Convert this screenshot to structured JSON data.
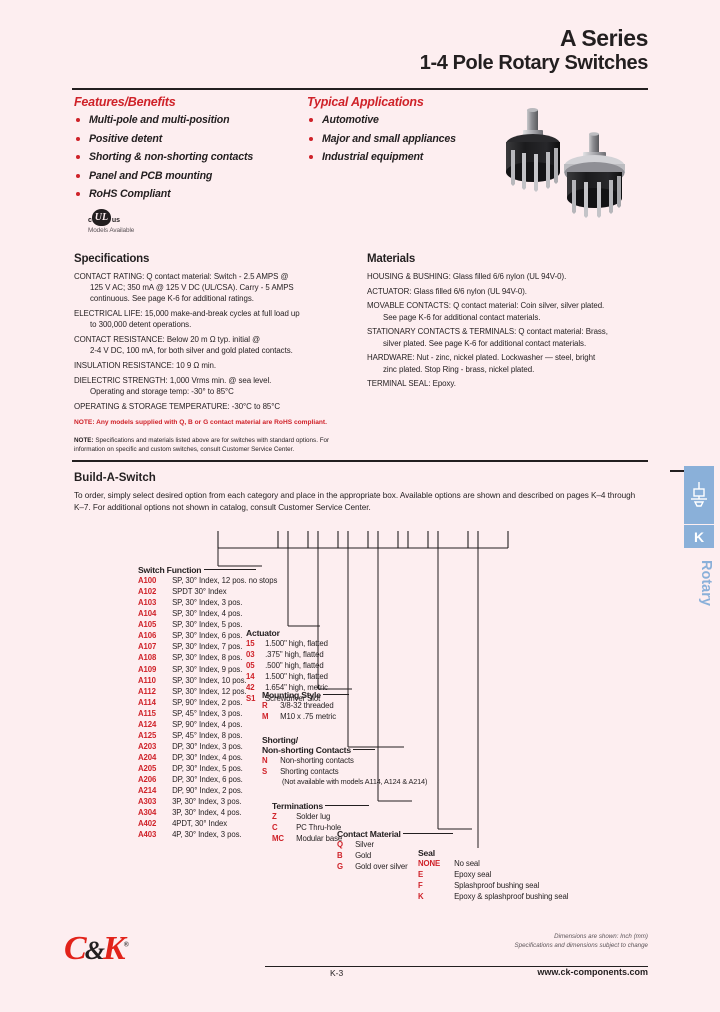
{
  "header": {
    "title": "A Series",
    "subtitle": "1-4 Pole Rotary Switches"
  },
  "features": {
    "heading": "Features/Benefits",
    "items": [
      "Multi-pole and multi-position",
      "Positive detent",
      "Shorting & non-shorting contacts",
      "Panel and PCB mounting",
      "RoHS Compliant"
    ],
    "ul_mark": {
      "left": "c",
      "mark": "UL",
      "right": "us",
      "caption": "Models Available"
    }
  },
  "applications": {
    "heading": "Typical Applications",
    "items": [
      "Automotive",
      "Major and small appliances",
      "Industrial equipment"
    ]
  },
  "specifications": {
    "heading": "Specifications",
    "items": [
      {
        "label": "CONTACT RATING:",
        "line1": "Q contact material: Switch - 2.5 AMPS @",
        "lines": [
          "125 V AC; 350 mA @ 125 V DC (UL/CSA). Carry - 5 AMPS",
          "continuous. See page K-6 for additional ratings."
        ]
      },
      {
        "label": "ELECTRICAL LIFE:",
        "line1": "15,000 make-and-break cycles at full load up",
        "lines": [
          "to 300,000 detent operations."
        ]
      },
      {
        "label": "CONTACT RESISTANCE:",
        "line1": "Below 20 m Ω typ. initial @",
        "lines": [
          "2-4 V DC, 100 mA, for both silver and gold plated contacts."
        ]
      },
      {
        "label": "INSULATION RESISTANCE:",
        "line1": "10 9 Ω min.",
        "lines": []
      },
      {
        "label": "DIELECTRIC STRENGTH:",
        "line1": "1,000 Vrms min. @ sea level.",
        "lines": [
          "Operating and storage temp: -30° to 85°C"
        ]
      },
      {
        "label": "OPERATING & STORAGE TEMPERATURE:",
        "line1": "-30°C to 85°C",
        "lines": []
      }
    ],
    "note_red": "NOTE: Any models supplied with Q, B or G contact material are RoHS compliant.",
    "note_black_bold": "NOTE:",
    "note_black": " Specifications and materials listed above are for switches with standard options. For information on specific and custom switches, consult Customer Service Center."
  },
  "materials": {
    "heading": "Materials",
    "items": [
      {
        "label": "HOUSING & BUSHING:",
        "line1": "Glass filled 6/6 nylon (UL 94V-0).",
        "lines": []
      },
      {
        "label": "ACTUATOR:",
        "line1": "Glass filled 6/6 nylon (UL 94V-0).",
        "lines": []
      },
      {
        "label": "MOVABLE CONTACTS:",
        "line1": "Q contact material: Coin silver, silver plated.",
        "lines": [
          "See page K-6 for additional contact materials."
        ]
      },
      {
        "label": "STATIONARY CONTACTS & TERMINALS:",
        "line1": "Q contact material: Brass,",
        "lines": [
          "silver plated. See page K-6 for additional contact materials."
        ]
      },
      {
        "label": "HARDWARE:",
        "line1": "Nut - zinc, nickel plated. Lockwasher — steel, bright",
        "lines": [
          "zinc plated. Stop Ring - brass, nickel plated."
        ]
      },
      {
        "label": "TERMINAL SEAL:",
        "line1": "Epoxy.",
        "lines": []
      }
    ]
  },
  "build_a_switch": {
    "heading": "Build-A-Switch",
    "intro": "To order, simply select desired option from each category and place in the appropriate box. Available options are shown and described on pages K–4 through K–7. For additional options not shown in catalog, consult Customer Service Center.",
    "groups": {
      "switch_function": {
        "title": "Switch Function",
        "options": [
          {
            "code": "A100",
            "desc": "SP, 30° Index, 12 pos. no stops"
          },
          {
            "code": "A102",
            "desc": "SPDT 30° Index"
          },
          {
            "code": "A103",
            "desc": "SP, 30° Index, 3 pos."
          },
          {
            "code": "A104",
            "desc": "SP, 30° Index, 4 pos."
          },
          {
            "code": "A105",
            "desc": "SP, 30° Index, 5 pos."
          },
          {
            "code": "A106",
            "desc": "SP, 30° Index, 6 pos."
          },
          {
            "code": "A107",
            "desc": "SP, 30° Index, 7 pos."
          },
          {
            "code": "A108",
            "desc": "SP, 30° Index, 8 pos."
          },
          {
            "code": "A109",
            "desc": "SP, 30° Index, 9 pos."
          },
          {
            "code": "A110",
            "desc": "SP, 30° Index, 10 pos."
          },
          {
            "code": "A112",
            "desc": "SP, 30° Index, 12 pos."
          },
          {
            "code": "A114",
            "desc": "SP, 90° Index, 2 pos."
          },
          {
            "code": "A115",
            "desc": "SP, 45° Index, 3 pos."
          },
          {
            "code": "A124",
            "desc": "SP, 90° Index, 4 pos."
          },
          {
            "code": "A125",
            "desc": "SP, 45° Index, 8 pos."
          },
          {
            "code": "A203",
            "desc": "DP, 30° Index, 3 pos."
          },
          {
            "code": "A204",
            "desc": "DP, 30° Index, 4 pos."
          },
          {
            "code": "A205",
            "desc": "DP, 30° Index, 5 pos."
          },
          {
            "code": "A206",
            "desc": "DP, 30° Index, 6 pos."
          },
          {
            "code": "A214",
            "desc": "DP, 90° Index, 2 pos."
          },
          {
            "code": "A303",
            "desc": "3P, 30° Index, 3 pos."
          },
          {
            "code": "A304",
            "desc": "3P, 30° Index, 4 pos."
          },
          {
            "code": "A402",
            "desc": "4PDT, 30° Index"
          },
          {
            "code": "A403",
            "desc": "4P, 30° Index, 3 pos."
          }
        ]
      },
      "actuator": {
        "title": "Actuator",
        "options": [
          {
            "code": "15",
            "desc": "1.500\" high, flatted"
          },
          {
            "code": "03",
            "desc": ".375\" high, flatted"
          },
          {
            "code": "05",
            "desc": ".500\" high, flatted"
          },
          {
            "code": "14",
            "desc": "1.500\" high, flatted"
          },
          {
            "code": "42",
            "desc": "1.654\" high, metric"
          },
          {
            "code": "S1",
            "desc": "Screwdriver Slot"
          }
        ]
      },
      "mounting_style": {
        "title": "Mounting Style",
        "options": [
          {
            "code": "R",
            "desc": "3/8-32 threaded"
          },
          {
            "code": "M",
            "desc": "M10 x .75 metric"
          }
        ]
      },
      "shorting": {
        "title_line1": "Shorting/",
        "title_line2": "Non-shorting Contacts",
        "options": [
          {
            "code": "N",
            "desc": "Non-shorting contacts"
          },
          {
            "code": "S",
            "desc": "Shorting contacts"
          }
        ],
        "note": "(Not available with models A114, A124 & A214)"
      },
      "terminations": {
        "title": "Terminations",
        "options": [
          {
            "code": "Z",
            "desc": "Solder lug"
          },
          {
            "code": "C",
            "desc": "PC Thru-hole"
          },
          {
            "code": "MC",
            "desc": "Modular base"
          }
        ]
      },
      "contact_material": {
        "title": "Contact Material",
        "options": [
          {
            "code": "Q",
            "desc": "Silver"
          },
          {
            "code": "B",
            "desc": "Gold"
          },
          {
            "code": "G",
            "desc": "Gold over silver"
          }
        ]
      },
      "seal": {
        "title": "Seal",
        "options": [
          {
            "code": "NONE",
            "desc": "No seal"
          },
          {
            "code": "E",
            "desc": "Epoxy seal"
          },
          {
            "code": "F",
            "desc": "Splashproof bushing seal"
          },
          {
            "code": "K",
            "desc": "Epoxy & splashproof bushing seal"
          }
        ]
      }
    }
  },
  "side_tab": {
    "icon": "rotary-switch-icon",
    "letter": "K",
    "word": "Rotary",
    "color": "#8ab0d9"
  },
  "footer": {
    "logo_c": "C",
    "logo_amp": "&",
    "logo_k": "K",
    "page_number": "K-3",
    "note_line1": "Dimensions are shown: Inch (mm)",
    "note_line2": "Specifications and dimensions subject to change",
    "url": "www.ck-components.com"
  },
  "colors": {
    "page_bg": "#fdeef0",
    "accent_red": "#cf2229",
    "ink": "#231f20",
    "tab_blue": "#8ab0d9"
  }
}
